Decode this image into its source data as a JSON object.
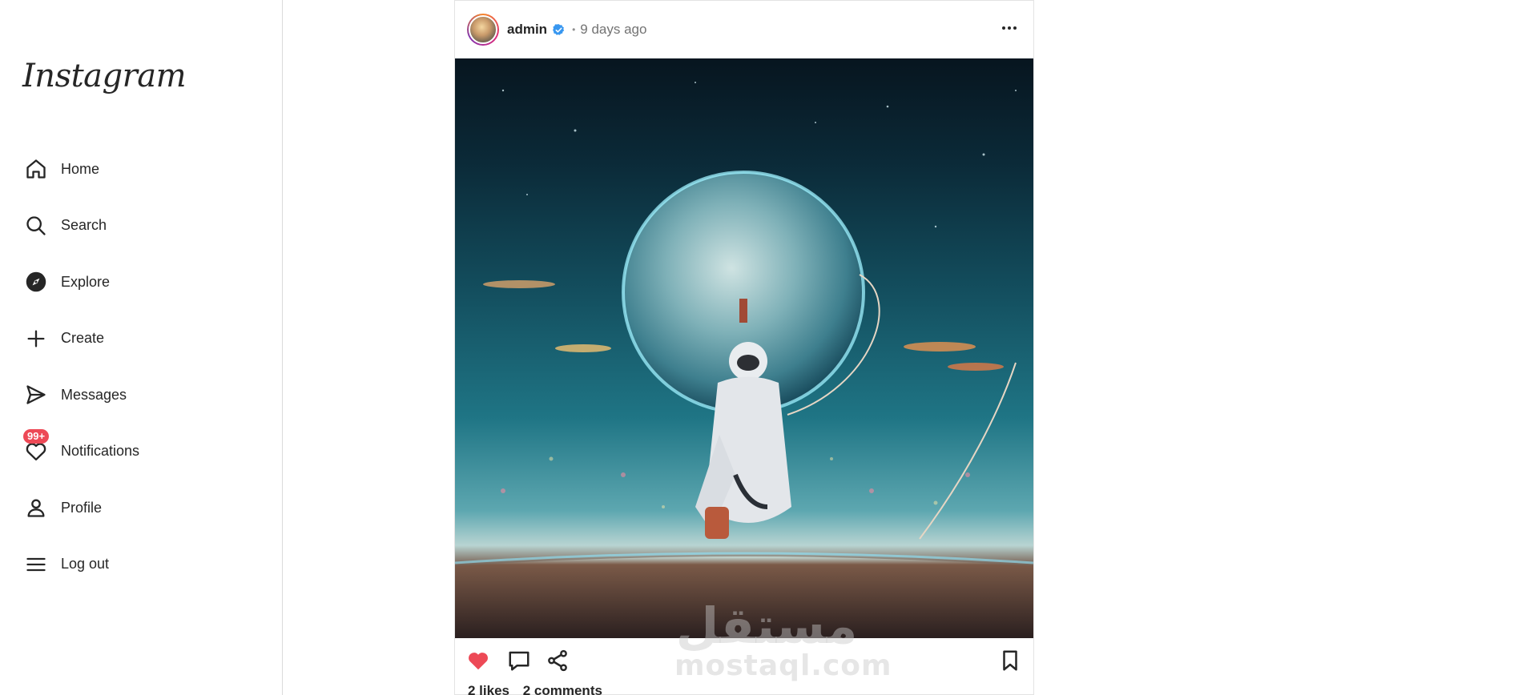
{
  "app": {
    "logo_text": "Instagram"
  },
  "sidebar": {
    "items": [
      {
        "label": "Home",
        "icon": "home-icon"
      },
      {
        "label": "Search",
        "icon": "search-icon"
      },
      {
        "label": "Explore",
        "icon": "compass-icon"
      },
      {
        "label": "Create",
        "icon": "plus-icon"
      },
      {
        "label": "Messages",
        "icon": "send-icon"
      },
      {
        "label": "Notifications",
        "icon": "heart-icon",
        "badge": "99+"
      },
      {
        "label": "Profile",
        "icon": "user-icon"
      },
      {
        "label": "Log out",
        "icon": "menu-icon"
      }
    ]
  },
  "post": {
    "username": "admin",
    "verified": true,
    "separator": "•",
    "time": "9 days ago",
    "likes_text": "2 likes",
    "comments_text": "2 comments",
    "liked": true
  },
  "watermark": {
    "arabic": "مستقل",
    "latin": "mostaql.com"
  },
  "colors": {
    "like": "#ed4956",
    "verified": "#3897f0",
    "badge": "#ed4956"
  }
}
